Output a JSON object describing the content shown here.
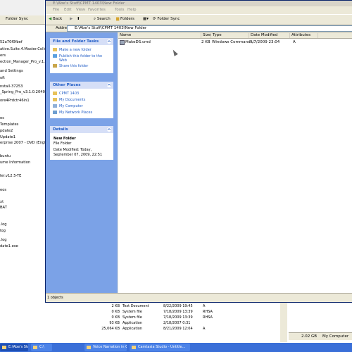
{
  "back_window": {
    "toolbar_label": "Folder Sync",
    "tree_items": [
      "52a70f0fbef",
      "ative.Suite.4.Master.Collect",
      "ers",
      "ection_Manager_Pro_v.1.10",
      "and Settings",
      "oft",
      "nstall-37253",
      "_Spring_Pro_v3.1.0.2040.",
      "ore4Prdctr46in1",
      "",
      "es",
      " Templates",
      "pdate2",
      "Update1",
      "erprise 2007 - DVD (English)",
      "buntu",
      "ume Information",
      "ler.v12.5-TE",
      "eos",
      "xt",
      "BAT",
      "",
      ".log",
      "log",
      ".log",
      "date1.exe"
    ],
    "bottom_rows": [
      {
        "size": "2 KB",
        "type": "Text Document",
        "date": "8/22/2009 19:45",
        "attr": "A"
      },
      {
        "size": "0 KB",
        "type": "System file",
        "date": "7/18/2009 13:39",
        "attr": "RHSA"
      },
      {
        "size": "0 KB",
        "type": "System file",
        "date": "7/18/2009 13:39",
        "attr": "RHSA"
      },
      {
        "size": "93 KB",
        "type": "Application",
        "date": "2/18/2007 0:31",
        "attr": ""
      },
      {
        "size": "25,064 KB",
        "type": "Application",
        "date": "8/21/2009 12:04",
        "attr": "A"
      }
    ],
    "status_size": "2.02 GB",
    "status_location": "My Computer"
  },
  "front_window": {
    "title": "E:\\Abe's Stuff\\CPMT 1403\\New Folder",
    "menu": [
      "File",
      "Edit",
      "View",
      "Favorites",
      "Tools",
      "Help"
    ],
    "toolbar": {
      "back": "Back",
      "search": "Search",
      "folders": "Folders",
      "folder_sync": "Folder Sync"
    },
    "address_label": "Address",
    "address_value": "E:\\Abe's Stuff\\CPMT 1403\\New Folder",
    "file_tasks": {
      "title": "File and Folder Tasks",
      "items": [
        "Make a new folder",
        "Publish this folder to the",
        "Web",
        "Share this folder"
      ]
    },
    "other_places": {
      "title": "Other Places",
      "items": [
        "CPMT 1403",
        "My Documents",
        "My Computer",
        "My Network Places"
      ]
    },
    "details": {
      "title": "Details",
      "name": "New Folder",
      "kind": "File Folder",
      "modified_line1": "Date Modified: Today,",
      "modified_line2": "September 07, 2009, 22:51"
    },
    "columns": {
      "name": "Name",
      "size": "Size",
      "type": "Type",
      "date": "Date Modified",
      "attributes": "Attributes"
    },
    "files": [
      {
        "name": "MakeDS.cmd",
        "size": "2 KB",
        "type": "Windows Command ...",
        "date": "9/7/2009 23:04",
        "attr": "A"
      }
    ],
    "status": "1 objects"
  },
  "taskbar": {
    "buttons": [
      "E:\\Abe's Stuff\\CPMT 140...",
      "C:\\",
      "Voice Narration in Camta...",
      "Camtasia Studio - Untitle..."
    ]
  },
  "colors": {
    "task_pane_blue": "#7ba2e7",
    "panel_header": "#d6dff7",
    "link_blue": "#215dc6",
    "taskbar_blue": "#3a6fd8"
  }
}
